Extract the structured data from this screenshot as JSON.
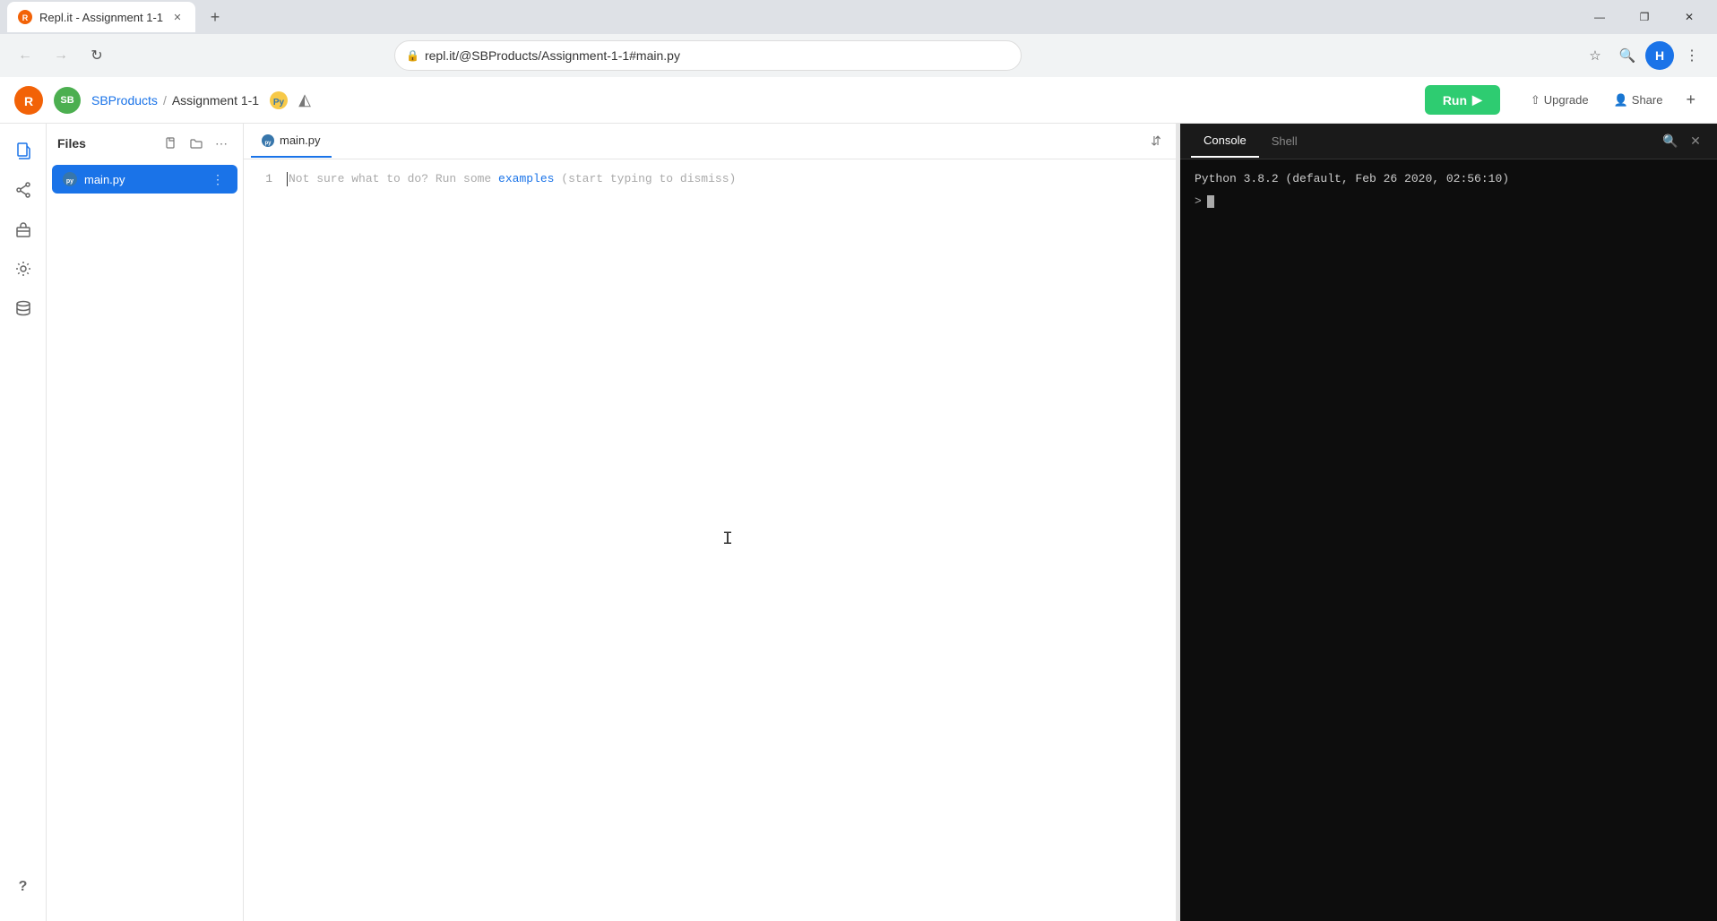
{
  "browser": {
    "tab_title": "Repl.it - Assignment 1-1",
    "tab_favicon": "🔵",
    "url": "repl.it/@SBProducts/Assignment-1-1#main.py",
    "new_tab_icon": "+",
    "window_minimize": "—",
    "window_maximize": "❐",
    "window_close": "✕"
  },
  "header": {
    "user": "SBProducts",
    "separator": "/",
    "repl_name": "Assignment 1-1",
    "run_label": "Run",
    "upgrade_label": "Upgrade",
    "share_label": "Share",
    "plus_label": "+"
  },
  "file_panel": {
    "title": "Files",
    "files": [
      {
        "name": "main.py",
        "active": true
      }
    ],
    "new_file_icon": "📄",
    "new_folder_icon": "📁",
    "more_icon": "⋯"
  },
  "editor": {
    "tab_label": "main.py",
    "line_numbers": [
      "1"
    ],
    "placeholder": "Not sure what to do? Run some examples (start typing to dismiss)",
    "placeholder_link": "examples"
  },
  "console": {
    "tabs": [
      {
        "label": "Console",
        "active": true
      },
      {
        "label": "Shell",
        "active": false
      }
    ],
    "python_version": "Python 3.8.2 (default, Feb 26 2020, 02:56:10)",
    "prompt_symbol": ">",
    "search_icon": "🔍",
    "close_icon": "✕"
  },
  "sidebar_icons": {
    "files": "📄",
    "share": "↗",
    "packages": "📦",
    "settings": "⚙",
    "database": "🗄",
    "help": "?"
  }
}
